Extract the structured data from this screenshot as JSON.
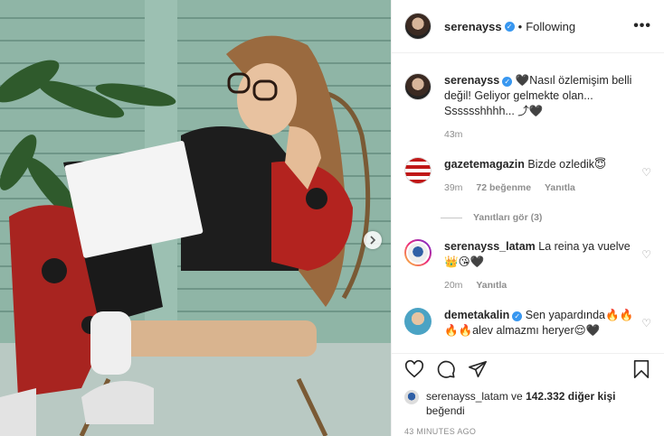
{
  "header": {
    "username": "serenayss",
    "separator": "•",
    "follow_status": "Following",
    "more_label": "•••"
  },
  "caption": {
    "username": "serenayss",
    "text": "🖤Nasıl özlemişim belli değil! Geliyor gelmekte olan... Sssssshhhh... ⤴🖤",
    "age": "43m"
  },
  "comments": [
    {
      "username": "gazetemagazin",
      "text": "Bizde ozledik😇",
      "age": "39m",
      "likes": "72 beğenme",
      "reply": "Yanıtla",
      "view_replies": "Yanıtları gör (3)"
    },
    {
      "username": "serenayss_latam",
      "text": "La reina ya vuelve 👑😘🖤",
      "age": "20m",
      "reply": "Yanıtla"
    },
    {
      "username": "demetakalin",
      "text": "Sen yapardında🔥🔥🔥🔥alev almazmı heryer😌🖤"
    }
  ],
  "likes": {
    "user": "serenayss_latam",
    "mid": " ve ",
    "others": "142.332 diğer kişi",
    "suffix": "beğendi"
  },
  "timestamp": "43 MINUTES AGO",
  "icons": {
    "verified": "verified-badge",
    "like": "heart-icon",
    "comment": "comment-icon",
    "share": "share-icon",
    "save": "bookmark-icon",
    "next": "chevron-right-icon"
  },
  "colors": {
    "verified": "#3897f0",
    "muted": "#8e8e8e",
    "text": "#262626"
  }
}
